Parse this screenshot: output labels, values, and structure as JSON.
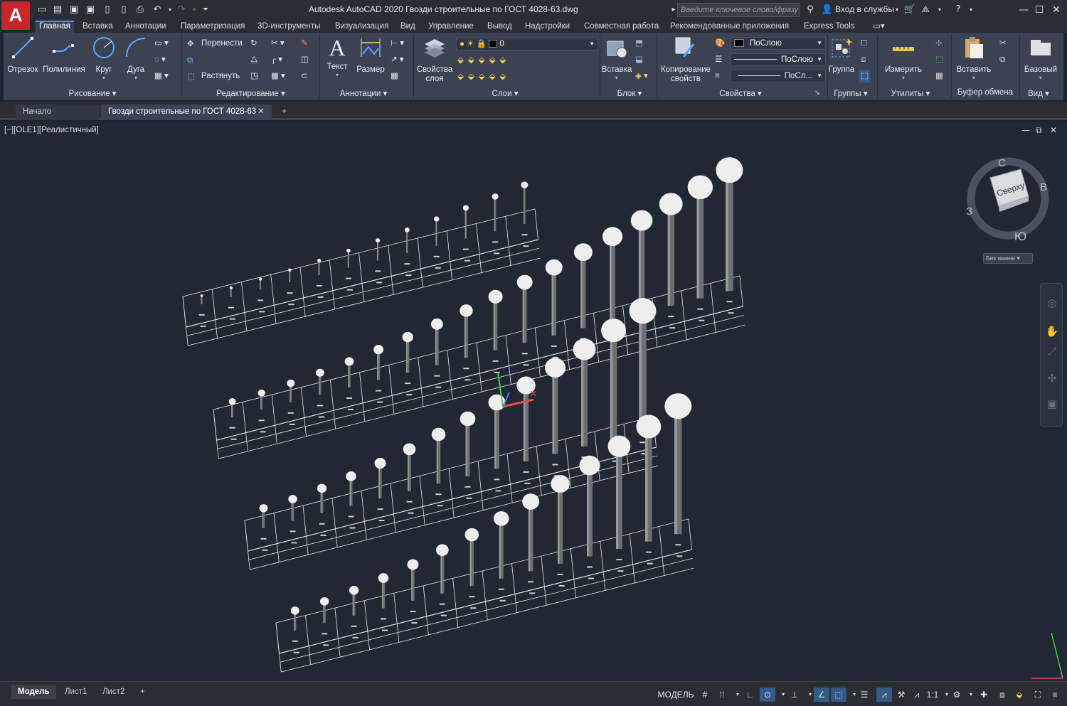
{
  "app": {
    "logo_letter": "A",
    "window_title": "Autodesk AutoCAD 2020   Гвозди строительные по ГОСТ 4028-63.dwg",
    "search_placeholder": "Введите ключевое слово/фразу",
    "sign_in": "Вход в службы",
    "accent_color": "#c8262b"
  },
  "ribbon_tabs": [
    "Главная",
    "Вставка",
    "Аннотации",
    "Параметризация",
    "3D-инструменты",
    "Визуализация",
    "Вид",
    "Управление",
    "Вывод",
    "Надстройки",
    "Совместная работа",
    "Рекомендованные приложения",
    "Express Tools"
  ],
  "ribbon": {
    "draw": {
      "title": "Рисование",
      "line": "Отрезок",
      "polyline": "Полилиния",
      "circle": "Круг",
      "arc": "Дуга"
    },
    "modify": {
      "title": "Редактирование",
      "move": "Перенести",
      "stretch": "Растянуть"
    },
    "annotation": {
      "title": "Аннотации",
      "text": "Текст",
      "dimension": "Размер"
    },
    "layers": {
      "title": "Слои",
      "properties": "Свойства слоя",
      "current_layer": "0"
    },
    "block": {
      "title": "Блок",
      "insert": "Вставка"
    },
    "properties": {
      "title": "Свойства",
      "match": "Копирование свойств",
      "color": "ПоСлою",
      "linetype": "ПоСлою",
      "lineweight": "ПоСл..."
    },
    "groups": {
      "title": "Группы",
      "group": "Группа"
    },
    "utilities": {
      "title": "Утилиты",
      "measure": "Измерить"
    },
    "clipboard": {
      "title": "Буфер обмена",
      "paste": "Вставить"
    },
    "view": {
      "title": "Вид",
      "base": "Базовый"
    }
  },
  "doc_tabs": {
    "start": "Начало",
    "active": "Гвозди строительные по ГОСТ 4028-63"
  },
  "viewport": {
    "label": "[−][OLE1][Реалистичный]",
    "viewcube_top": "Сверху",
    "compass": {
      "n": "С",
      "e": "В",
      "s": "Ю",
      "w": "З"
    },
    "ucs_name": "Без имени"
  },
  "status": {
    "layouts": [
      "Модель",
      "Лист1",
      "Лист2"
    ],
    "model_label": "МОДЕЛЬ",
    "scale": "1:1"
  }
}
